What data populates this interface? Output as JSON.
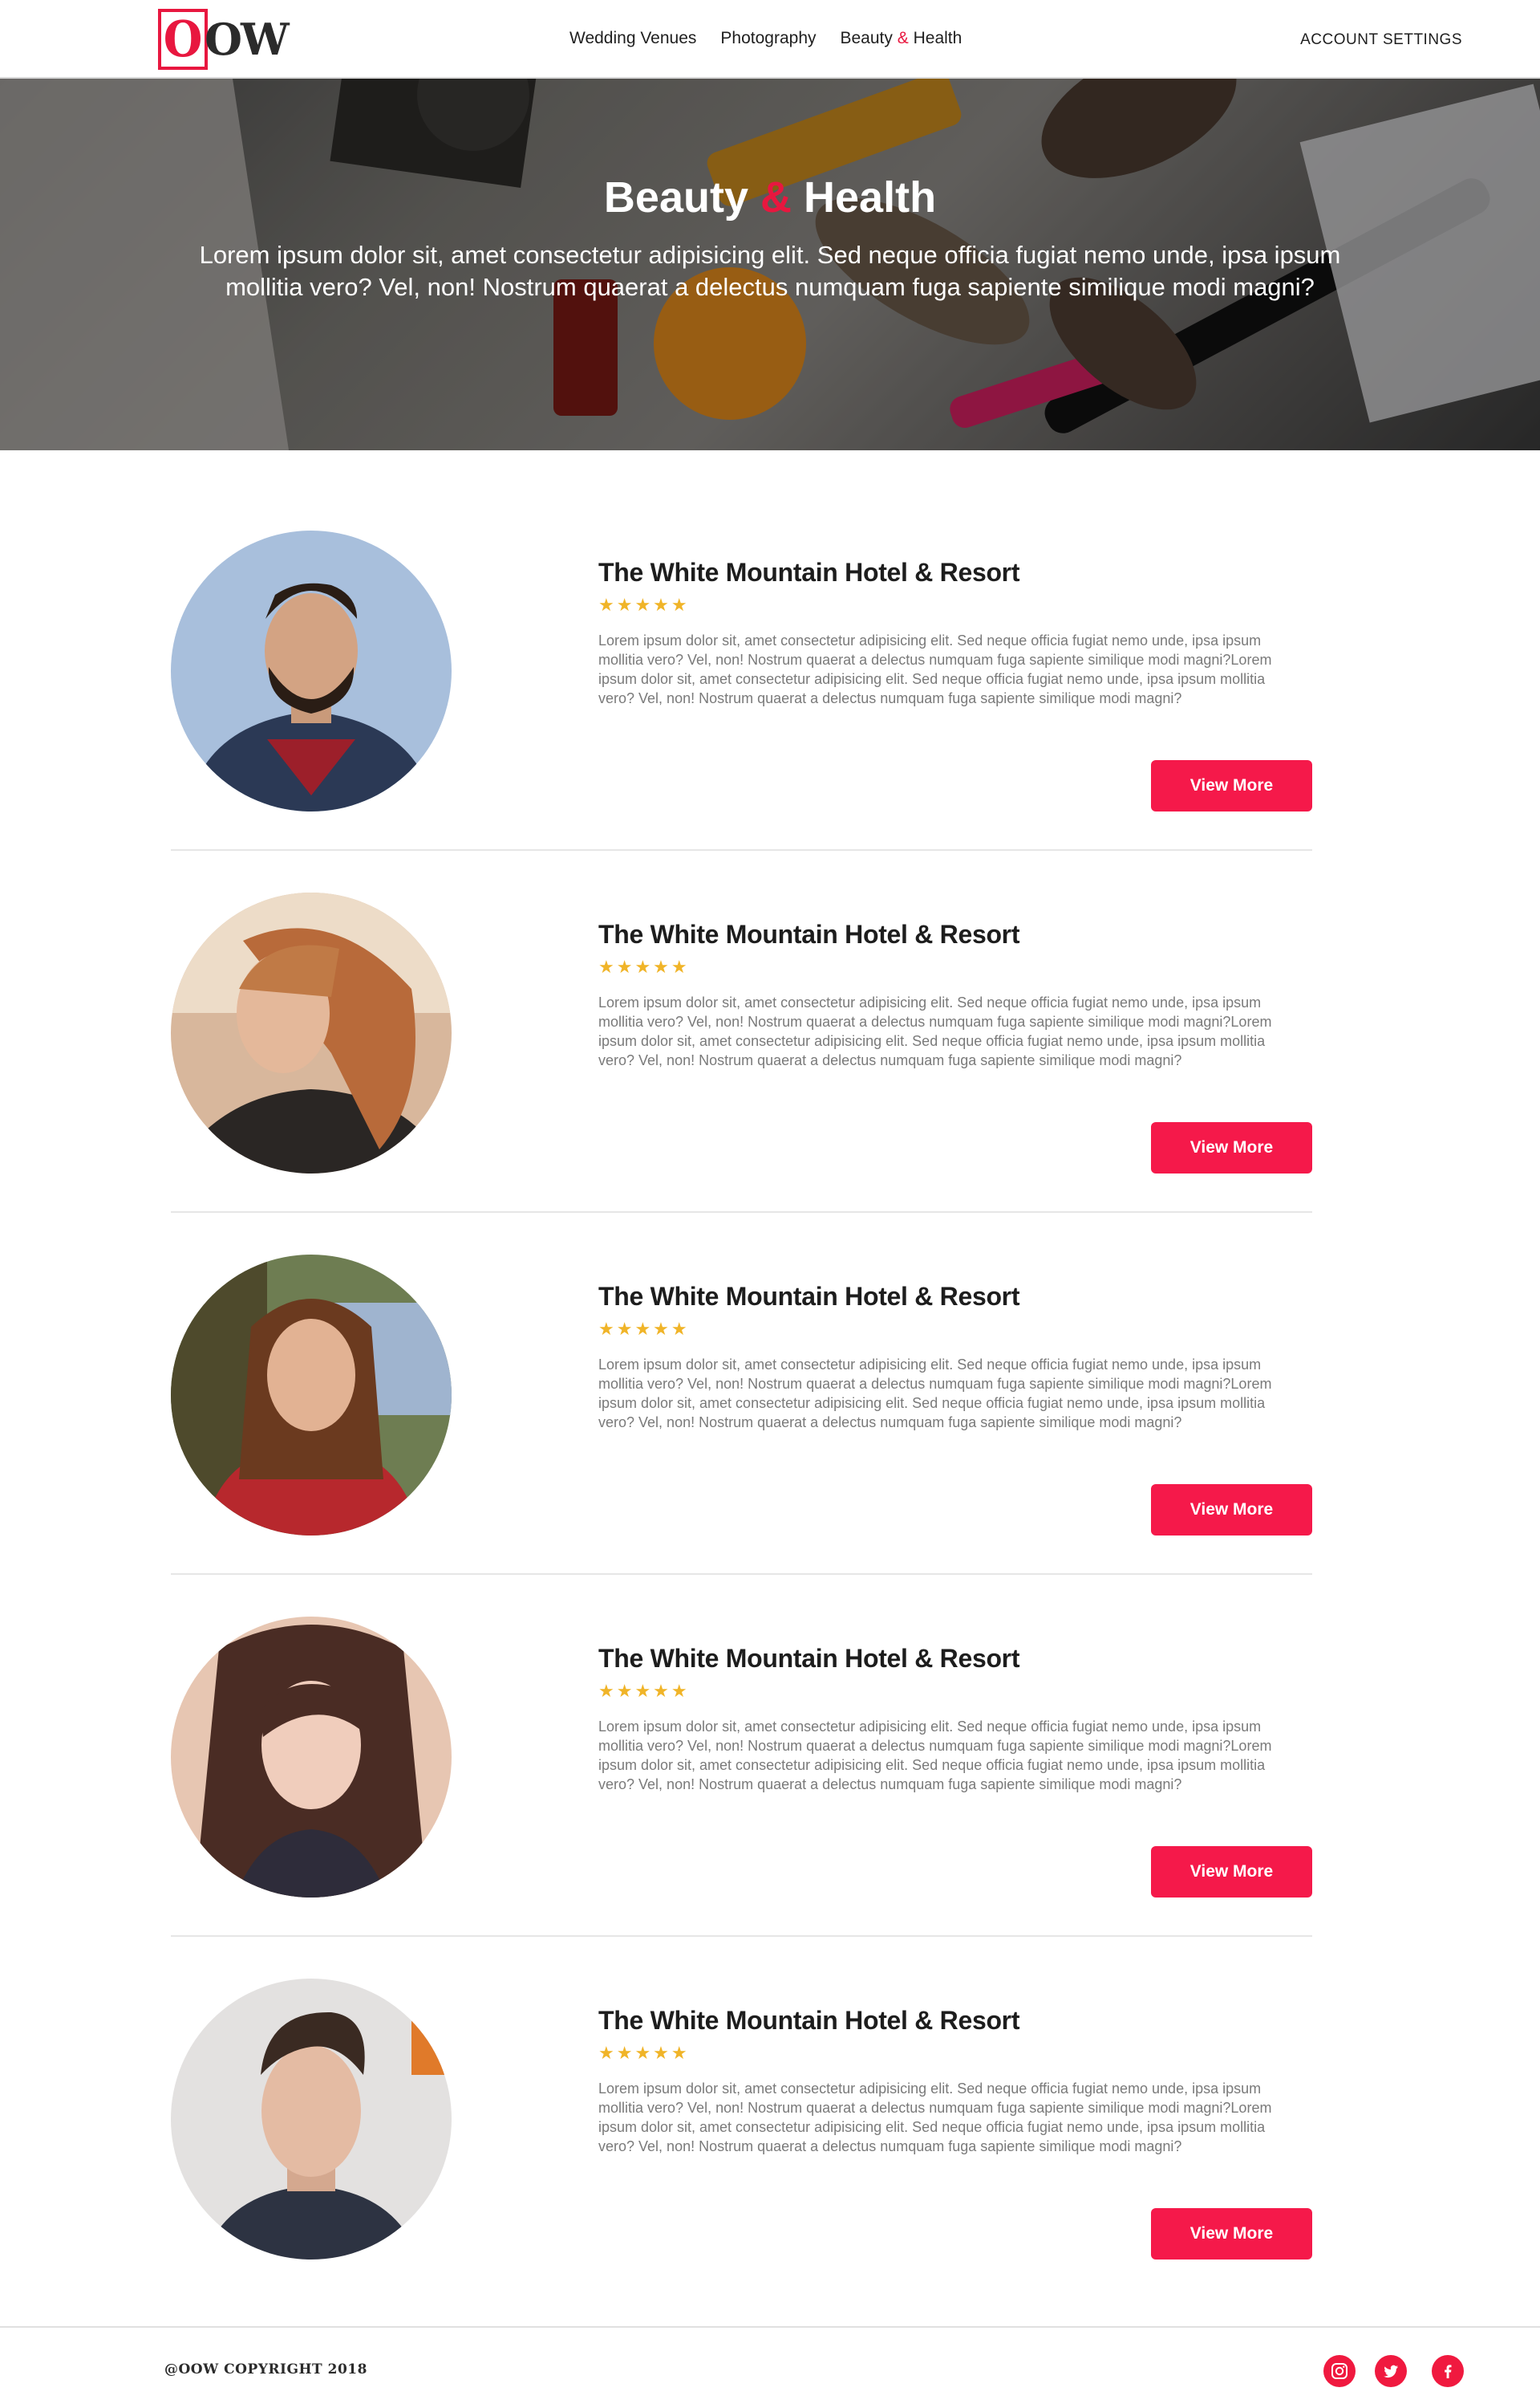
{
  "header": {
    "logo_first": "O",
    "logo_rest": "OW",
    "nav": {
      "wedding": "Wedding Venues",
      "photography": "Photography",
      "beauty_a": "Beauty",
      "beauty_amp": "&",
      "beauty_b": "Health"
    },
    "account": "ACCOUNT SETTINGS"
  },
  "hero": {
    "title_a": "Beauty",
    "title_amp": "&",
    "title_b": "Health",
    "text": "Lorem ipsum dolor sit, amet consectetur adipisicing elit. Sed neque officia fugiat nemo unde, ipsa ipsum mollitia vero? Vel, non! Nostrum quaerat a delectus numquam fuga sapiente similique modi magni?"
  },
  "listings": [
    {
      "title": "The White Mountain Hotel & Resort",
      "stars": "★★★★★",
      "rating": 5,
      "description": "Lorem ipsum dolor sit, amet consectetur adipisicing elit. Sed neque officia fugiat nemo unde, ipsa ipsum mollitia vero? Vel, non! Nostrum quaerat a delectus numquam fuga sapiente similique modi magni?Lorem ipsum dolor sit, amet consectetur adipisicing elit. Sed neque officia fugiat nemo unde, ipsa ipsum mollitia vero? Vel, non! Nostrum quaerat a delectus numquam fuga sapiente similique modi magni?",
      "button": "View More"
    },
    {
      "title": "The White Mountain Hotel & Resort",
      "stars": "★★★★★",
      "rating": 5,
      "description": "Lorem ipsum dolor sit, amet consectetur adipisicing elit. Sed neque officia fugiat nemo unde, ipsa ipsum mollitia vero? Vel, non! Nostrum quaerat a delectus numquam fuga sapiente similique modi magni?Lorem ipsum dolor sit, amet consectetur adipisicing elit. Sed neque officia fugiat nemo unde, ipsa ipsum mollitia vero? Vel, non! Nostrum quaerat a delectus numquam fuga sapiente similique modi magni?",
      "button": "View More"
    },
    {
      "title": "The White Mountain Hotel & Resort",
      "stars": "★★★★★",
      "rating": 5,
      "description": "Lorem ipsum dolor sit, amet consectetur adipisicing elit. Sed neque officia fugiat nemo unde, ipsa ipsum mollitia vero? Vel, non! Nostrum quaerat a delectus numquam fuga sapiente similique modi magni?Lorem ipsum dolor sit, amet consectetur adipisicing elit. Sed neque officia fugiat nemo unde, ipsa ipsum mollitia vero? Vel, non! Nostrum quaerat a delectus numquam fuga sapiente similique modi magni?",
      "button": "View More"
    },
    {
      "title": "The White Mountain Hotel & Resort",
      "stars": "★★★★★",
      "rating": 5,
      "description": "Lorem ipsum dolor sit, amet consectetur adipisicing elit. Sed neque officia fugiat nemo unde, ipsa ipsum mollitia vero? Vel, non! Nostrum quaerat a delectus numquam fuga sapiente similique modi magni?Lorem ipsum dolor sit, amet consectetur adipisicing elit. Sed neque officia fugiat nemo unde, ipsa ipsum mollitia vero? Vel, non! Nostrum quaerat a delectus numquam fuga sapiente similique modi magni?",
      "button": "View More"
    },
    {
      "title": "The White Mountain Hotel & Resort",
      "stars": "★★★★★",
      "rating": 5,
      "description": "Lorem ipsum dolor sit, amet consectetur adipisicing elit. Sed neque officia fugiat nemo unde, ipsa ipsum mollitia vero? Vel, non! Nostrum quaerat a delectus numquam fuga sapiente similique modi magni?Lorem ipsum dolor sit, amet consectetur adipisicing elit. Sed neque officia fugiat nemo unde, ipsa ipsum mollitia vero? Vel, non! Nostrum quaerat a delectus numquam fuga sapiente similique modi magni?",
      "button": "View More"
    }
  ],
  "footer": {
    "copyright": "@OOW COPYRIGHT  2018",
    "social": [
      "instagram-icon",
      "twitter-icon",
      "facebook-icon"
    ]
  },
  "colors": {
    "accent": "#f5194a",
    "stars": "#f0b428",
    "text_dark": "#1d1d1d",
    "text_muted": "#7a7a7a"
  }
}
